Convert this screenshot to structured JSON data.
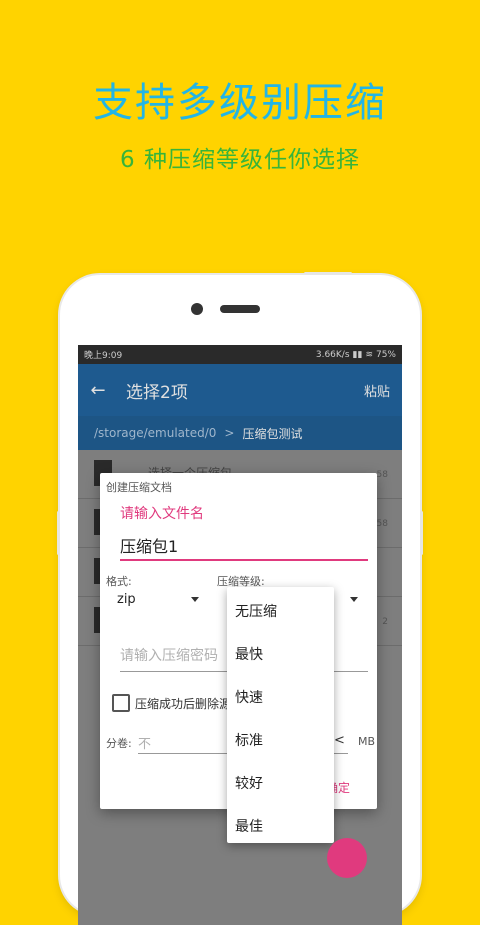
{
  "promo": {
    "title": "支持多级别压缩",
    "subtitle": "6 种压缩等级任你选择"
  },
  "status_bar": {
    "time": "晚上9:09",
    "network_speed": "3.66K/s",
    "battery": "75%"
  },
  "toolbar": {
    "back_icon": "arrow-left-icon",
    "title": "选择2项",
    "paste_label": "粘贴"
  },
  "path_bar": {
    "path": "/storage/emulated/0",
    "separator": ">",
    "current": "压缩包测试"
  },
  "file_list": [
    {
      "name": "选择一个压缩包",
      "size": "58"
    },
    {
      "name": "",
      "size": "58"
    },
    {
      "name": "",
      "size": ""
    },
    {
      "name": "",
      "size": "2"
    }
  ],
  "dialog": {
    "title": "创建压缩文档",
    "filename_label": "请输入文件名",
    "filename_value": "压缩包1",
    "format_label": "格式:",
    "format_value": "zip",
    "level_label": "压缩等级:",
    "password_placeholder": "请输入压缩密码",
    "delete_after_label": "压缩成功后删除源文件",
    "split_label": "分卷:",
    "split_placeholder": "不",
    "split_arrow": "<",
    "split_unit": "MB",
    "confirm_label": "确定"
  },
  "level_options": [
    "无压缩",
    "最快",
    "快速",
    "标准",
    "较好",
    "最佳"
  ],
  "colors": {
    "background": "#FFD300",
    "title": "#22B5E6",
    "subtitle": "#38B43A",
    "toolbar": "#1E5A8F",
    "accent": "#E03A7E"
  }
}
